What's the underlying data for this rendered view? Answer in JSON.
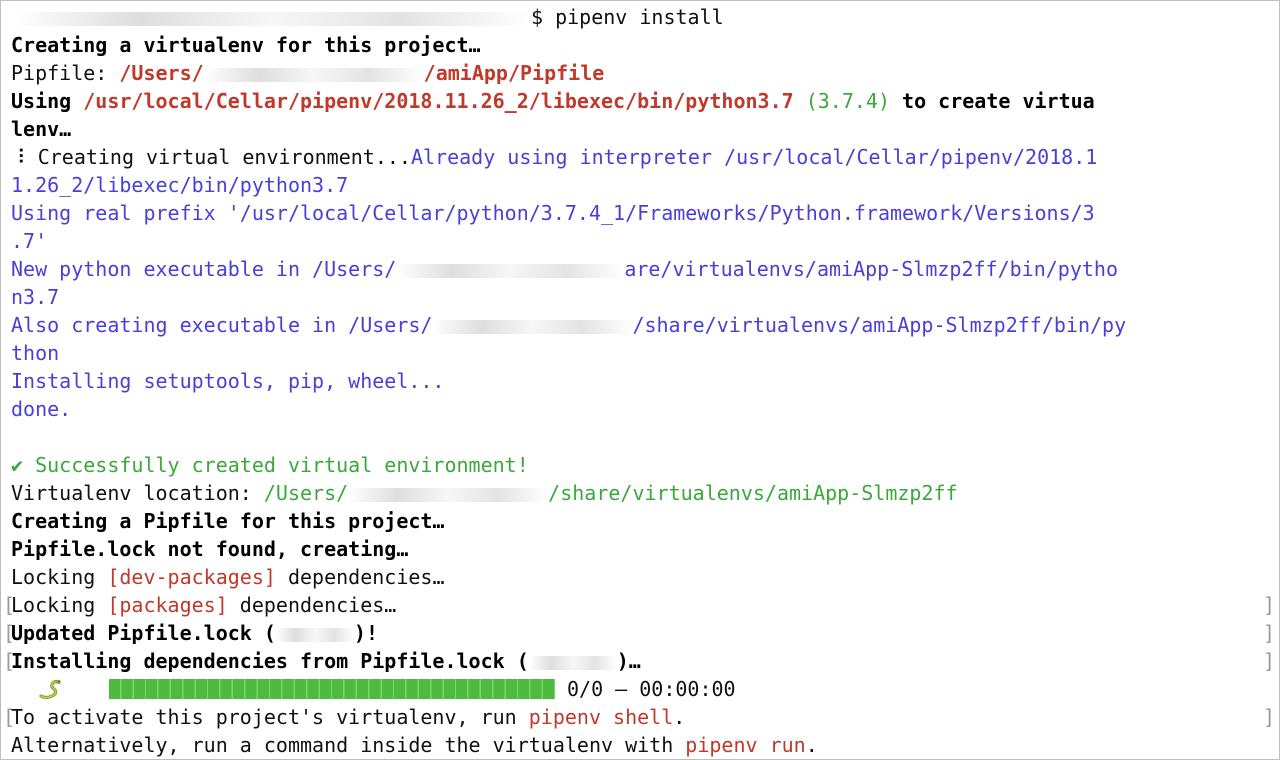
{
  "terminal": {
    "prompt_line": "$ pipenv install",
    "l1": "Creating a virtualenv for this project…",
    "l2_label": "Pipfile: ",
    "l2_path_a": "/Users/",
    "l2_path_b": "/amiApp/Pipfile",
    "l3_a": "Using ",
    "l3_path": "/usr/local/Cellar/pipenv/2018.11.26_2/libexec/bin/python3.7",
    "l3_ver": " (3.7.4)",
    "l3_b": " to create virtua",
    "l4": "lenv…",
    "l5_a": "⠸ Creating virtual environment...",
    "l5_b": "Already using interpreter /usr/local/Cellar/pipenv/2018.1",
    "l6": "1.26_2/libexec/bin/python3.7",
    "l7": "Using real prefix '/usr/local/Cellar/python/3.7.4_1/Frameworks/Python.framework/Versions/3",
    "l8": ".7'",
    "l9_a": "New python executable in /Users/",
    "l9_b": "are/virtualenvs/amiApp-Slmzp2ff/bin/pytho",
    "l10": "n3.7",
    "l11_a": "Also creating executable in /Users/",
    "l11_b": "/share/virtualenvs/amiApp-Slmzp2ff/bin/py",
    "l12": "thon",
    "l13": "Installing setuptools, pip, wheel...",
    "l14": "done.",
    "l16": "✔ Successfully created virtual environment!",
    "l17_label": "Virtualenv location: ",
    "l17_a": "/Users/",
    "l17_b": "/share/virtualenvs/amiApp-Slmzp2ff",
    "l18": "Creating a Pipfile for this project…",
    "l19": "Pipfile.lock not found, creating…",
    "l20_a": "Locking ",
    "l20_tag": "[dev-packages]",
    "l20_b": " dependencies…",
    "l21_a": "Locking ",
    "l21_tag": "[packages]",
    "l21_b": " dependencies…",
    "l22_a": "Updated Pipfile.lock (",
    "l22_b": ")!",
    "l23_a": "Installing dependencies from Pipfile.lock (",
    "l23_b": ")…",
    "progress_text": "0/0 — 00:00:00",
    "progress_fraction": 1.0,
    "l25_a": "To activate this project's virtualenv, run ",
    "l25_cmd": "pipenv shell",
    "l25_b": ".",
    "l26_a": "Alternatively, run a command inside the virtualenv with ",
    "l26_cmd": "pipenv run",
    "l26_b": "."
  },
  "icons": {
    "progress": "snake-icon"
  },
  "colors": {
    "path_red": "#c0392b",
    "info_blue": "#4a3fd6",
    "success_green": "#3aa93a",
    "progress_green": "#4cbb3f"
  }
}
